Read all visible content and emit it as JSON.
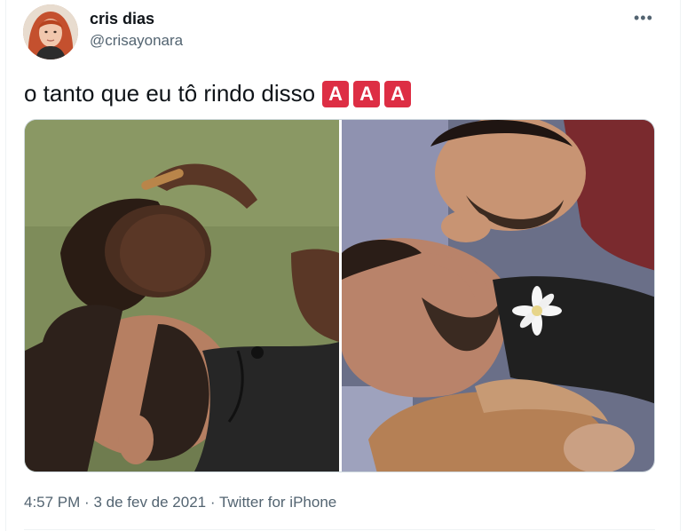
{
  "author": {
    "name": "cris dias",
    "handle": "@crisayonara",
    "avatar_icon": "profile-avatar-icon"
  },
  "menu_icon": "more-horizontal-icon",
  "tweet": {
    "text": "o tanto que eu tô rindo disso",
    "emoji": [
      "A",
      "A",
      "A"
    ],
    "emoji_color": "#dd2e44"
  },
  "media": {
    "left_photo_icon": "photo-two-people-lying-on-grass-icon",
    "right_photo_icon": "photo-three-people-lying-on-bed-with-flower-icon"
  },
  "meta": {
    "time": "4:57 PM",
    "sep1": "·",
    "date": "3 de fev de 2021",
    "sep2": "·",
    "source": "Twitter for iPhone"
  },
  "colors": {
    "text": "#0f1419",
    "secondary": "#536471",
    "border": "#cfd9de"
  }
}
